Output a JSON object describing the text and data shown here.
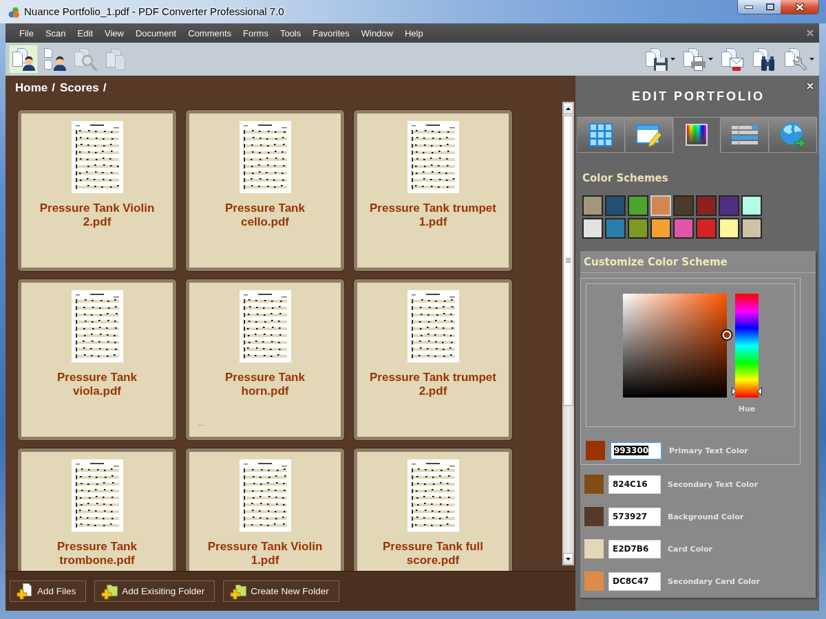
{
  "window": {
    "title": "Nuance Portfolio_1.pdf - PDF Converter Professional 7.0"
  },
  "menu": [
    "File",
    "Scan",
    "Edit",
    "View",
    "Document",
    "Comments",
    "Forms",
    "Tools",
    "Favorites",
    "Window",
    "Help"
  ],
  "toolbar": {
    "left": [
      {
        "kind": "documents-person",
        "selected": true,
        "disabled": false
      },
      {
        "kind": "pages-person",
        "selected": false,
        "disabled": false
      },
      {
        "kind": "documents-magnifier",
        "selected": false,
        "disabled": true
      },
      {
        "kind": "documents-copy",
        "selected": false,
        "disabled": true
      }
    ],
    "right": [
      {
        "kind": "save",
        "dropdown": true
      },
      {
        "kind": "print",
        "dropdown": true
      },
      {
        "kind": "email",
        "dropdown": false
      },
      {
        "kind": "binoculars",
        "dropdown": false
      },
      {
        "kind": "wrench",
        "dropdown": true
      }
    ]
  },
  "breadcrumb": [
    {
      "label": "Home",
      "separator": "/"
    },
    {
      "label": "Scores",
      "separator": "/"
    }
  ],
  "cards": [
    {
      "name": "Pressure Tank Violin 2.pdf"
    },
    {
      "name": "Pressure Tank cello.pdf"
    },
    {
      "name": "Pressure Tank trumpet 1.pdf"
    },
    {
      "name": "Pressure Tank viola.pdf"
    },
    {
      "name": "Pressure Tank horn.pdf",
      "more_mark": "..."
    },
    {
      "name": "Pressure Tank trumpet 2.pdf"
    },
    {
      "name": "Pressure Tank trombone.pdf"
    },
    {
      "name": "Pressure Tank Violin 1.pdf"
    },
    {
      "name": "Pressure Tank full score.pdf"
    }
  ],
  "actions": [
    {
      "kind": "file",
      "label": "Add Files"
    },
    {
      "kind": "folder",
      "label": "Add Exisiting Folder"
    },
    {
      "kind": "folder",
      "label": "Create New Folder"
    }
  ],
  "edit_panel": {
    "title": "EDIT PORTFOLIO",
    "tabs": [
      {
        "kind": "grid",
        "selected": false
      },
      {
        "kind": "form",
        "selected": false
      },
      {
        "kind": "spectrum",
        "selected": true
      },
      {
        "kind": "table",
        "selected": false
      },
      {
        "kind": "globe",
        "selected": false
      }
    ],
    "color_schemes": {
      "title": "Color Schemes",
      "swatches": [
        {
          "color": "#a3967a",
          "selected": false
        },
        {
          "color": "#244f70",
          "selected": false
        },
        {
          "color": "#4ea42e",
          "selected": false
        },
        {
          "color": "#d08850",
          "selected": true
        },
        {
          "color": "#4b3b2b",
          "selected": false
        },
        {
          "color": "#8b2222",
          "selected": false
        },
        {
          "color": "#4f2f80",
          "selected": false
        },
        {
          "color": "#b5fbe8",
          "selected": false
        },
        {
          "color": "#e2e2e2",
          "selected": false
        },
        {
          "color": "#2b7eaa",
          "selected": false
        },
        {
          "color": "#7b9a22",
          "selected": false
        },
        {
          "color": "#f3a032",
          "selected": false
        },
        {
          "color": "#e055a8",
          "selected": false
        },
        {
          "color": "#d42424",
          "selected": false
        },
        {
          "color": "#fff59c",
          "selected": false
        },
        {
          "color": "#cdc2a8",
          "selected": false
        }
      ]
    },
    "customize": {
      "title": "Customize Color Scheme",
      "hue_slider": {
        "label": "Hue",
        "level": 0.06
      },
      "colors": [
        {
          "value": "993300",
          "label": "Primary Text Color",
          "color": "#993300",
          "selected": true
        },
        {
          "value": "824C16",
          "label": "Secondary Text Color",
          "color": "#824c16",
          "selected": false
        },
        {
          "value": "573927",
          "label": "Background Color",
          "color": "#573927",
          "selected": false
        },
        {
          "value": "E2D7B6",
          "label": "Card Color",
          "color": "#e2d7b6",
          "selected": false
        },
        {
          "value": "DC8C47",
          "label": "Secondary Card Color",
          "color": "#dc8c47",
          "selected": false
        }
      ]
    }
  }
}
